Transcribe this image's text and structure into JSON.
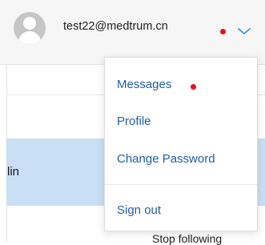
{
  "header": {
    "user_email": "test22@medtrum.cn",
    "has_notification": true,
    "avatar_icon": "user-avatar-icon",
    "menu_toggle_icon": "chevron-down-icon"
  },
  "background": {
    "partial_name": "lin",
    "action_link": "Stop following"
  },
  "dropdown_menu": {
    "items": [
      {
        "label": "Messages",
        "has_unread_dot": true
      },
      {
        "label": "Profile"
      },
      {
        "label": "Change Password"
      },
      {
        "label": "Sign out"
      }
    ]
  },
  "colors": {
    "link": "#1f5ea8",
    "notification_dot": "#e8101a",
    "selected_row": "#c9dff4"
  }
}
